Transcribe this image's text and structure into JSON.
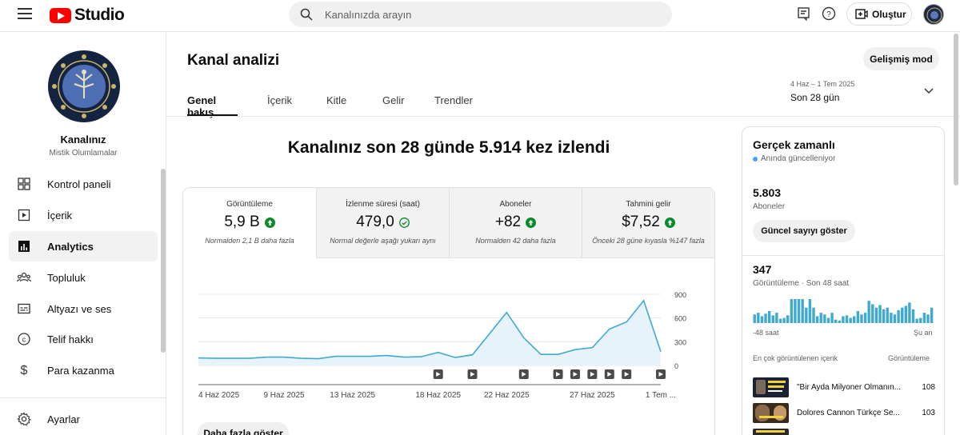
{
  "app": {
    "logo_text": "Studio"
  },
  "search": {
    "placeholder": "Kanalınızda arayın"
  },
  "header": {
    "create_label": "Oluştur"
  },
  "channel": {
    "name": "Kanalınız",
    "subtitle": "Mistik Olumlamalar"
  },
  "sidebar": {
    "items": [
      {
        "label": "Kontrol paneli",
        "icon": "dashboard-icon"
      },
      {
        "label": "İçerik",
        "icon": "content-icon"
      },
      {
        "label": "Analytics",
        "icon": "analytics-icon",
        "active": true
      },
      {
        "label": "Topluluk",
        "icon": "community-icon"
      },
      {
        "label": "Altyazı ve ses",
        "icon": "subtitles-icon"
      },
      {
        "label": "Telif hakkı",
        "icon": "copyright-icon"
      },
      {
        "label": "Para kazanma",
        "icon": "dollar-icon"
      },
      {
        "label": "Ayarlar",
        "icon": "gear-icon"
      }
    ]
  },
  "page": {
    "title": "Kanal analizi",
    "advanced_label": "Gelişmiş mod",
    "tabs": [
      "Genel bakış",
      "İçerik",
      "Kitle",
      "Gelir",
      "Trendler"
    ],
    "date_range_small": "4 Haz – 1 Tem 2025",
    "date_range_label": "Son 28 gün",
    "headline": "Kanalınız son 28 günde 5.914 kez izlendi",
    "more_label": "Daha fazla göster"
  },
  "metrics": [
    {
      "label": "Görüntüleme",
      "value": "5,9 B",
      "indicator": "up",
      "sub": "Normalden 2,1 B daha fazla"
    },
    {
      "label": "İzlenme süresi (saat)",
      "value": "479,0",
      "indicator": "check",
      "sub": "Normal değerle aşağı yukarı aynı"
    },
    {
      "label": "Aboneler",
      "value": "+82",
      "indicator": "up",
      "sub": "Normalden 42 daha fazla"
    },
    {
      "label": "Tahmini gelir",
      "value": "$7,52",
      "indicator": "up",
      "sub": "Önceki 28 güne kıyasla %147 fazla"
    }
  ],
  "colors": {
    "line": "#3fa9d0",
    "fill": "#e6f3fa",
    "up": "#0a8a2a",
    "dot": "#3ea6ff"
  },
  "chart_data": {
    "type": "area",
    "x": [
      "4 Haz",
      "5 Haz",
      "6 Haz",
      "7 Haz",
      "8 Haz",
      "9 Haz",
      "10 Haz",
      "11 Haz",
      "12 Haz",
      "13 Haz",
      "14 Haz",
      "15 Haz",
      "16 Haz",
      "17 Haz",
      "18 Haz",
      "19 Haz",
      "20 Haz",
      "21 Haz",
      "22 Haz",
      "23 Haz",
      "24 Haz",
      "25 Haz",
      "26 Haz",
      "27 Haz",
      "28 Haz",
      "29 Haz",
      "30 Haz",
      "1 Tem"
    ],
    "values": [
      95,
      90,
      90,
      90,
      105,
      105,
      90,
      85,
      115,
      115,
      115,
      125,
      105,
      110,
      165,
      100,
      135,
      400,
      670,
      350,
      140,
      140,
      200,
      225,
      460,
      550,
      820,
      175
    ],
    "ylim": [
      0,
      900
    ],
    "yticks": [
      "900",
      "600",
      "300",
      "0"
    ],
    "xtick_labels": [
      {
        "label": "4 Haz 2025",
        "index": 0
      },
      {
        "label": "9 Haz 2025",
        "index": 5
      },
      {
        "label": "13 Haz 2025",
        "index": 9
      },
      {
        "label": "18 Haz 2025",
        "index": 14
      },
      {
        "label": "22 Haz 2025",
        "index": 18
      },
      {
        "label": "27 Haz 2025",
        "index": 23
      },
      {
        "label": "1 Tem ...",
        "index": 27
      }
    ],
    "video_markers": [
      14,
      16,
      19,
      21,
      22,
      23,
      24,
      25,
      27
    ]
  },
  "realtime": {
    "title": "Gerçek zamanlı",
    "live_label": "Anında güncelleniyor",
    "subs_value": "5.803",
    "subs_label": "Aboneler",
    "show_button": "Güncel sayıyı göster",
    "views_value": "347",
    "views_label": "Görüntüleme · Son 48 saat",
    "axis_left": "-48 saat",
    "axis_right": "Şu an",
    "bars": [
      10,
      12,
      8,
      11,
      14,
      9,
      12,
      5,
      6,
      9,
      28,
      28,
      28,
      28,
      18,
      28,
      18,
      8,
      12,
      10,
      6,
      12,
      4,
      3,
      8,
      9,
      6,
      8,
      14,
      10,
      12,
      26,
      22,
      18,
      21,
      16,
      18,
      12,
      10,
      15,
      18,
      20,
      24,
      16,
      5,
      6,
      12,
      10,
      18
    ],
    "top_header": "En çok görüntülenen içerik",
    "top_value_header": "Görüntüleme",
    "top_items": [
      {
        "title": "\"Bir Ayda Milyoner Olmanın...",
        "views": "108"
      },
      {
        "title": "Dolores Cannon Türkçe Se...",
        "views": "103"
      }
    ]
  }
}
